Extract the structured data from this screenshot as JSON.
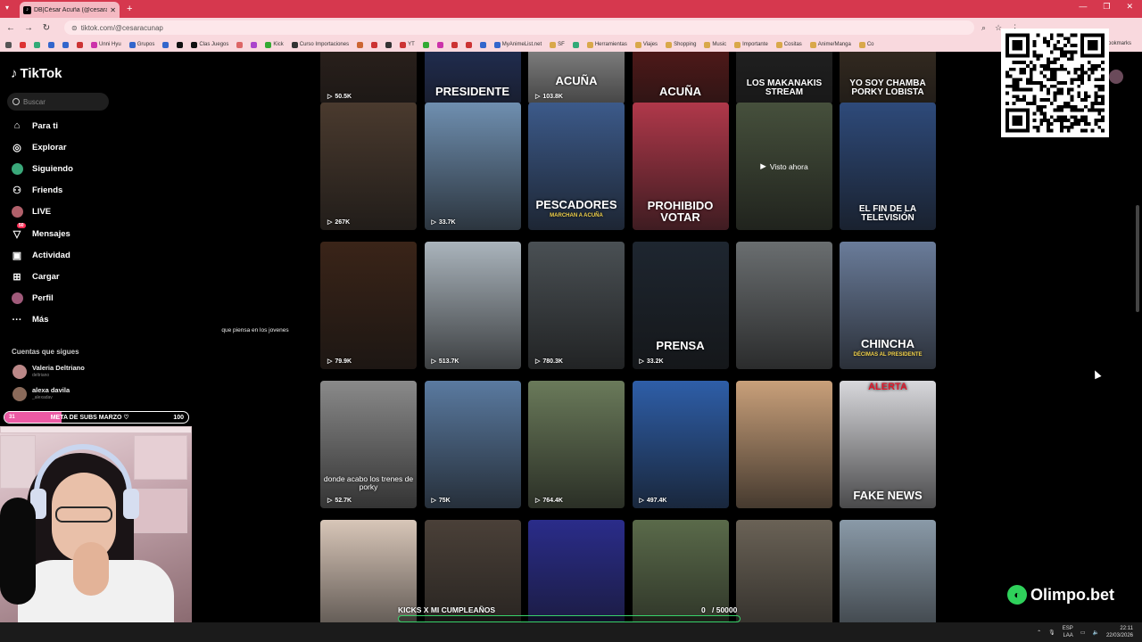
{
  "browser": {
    "tab_title": "DB|César Acuña (@cesaracunap",
    "url": "tiktok.com/@cesaracunap",
    "bookmarks": [
      "",
      "",
      "",
      "",
      "",
      "",
      "Unni Hyu",
      "Grupos",
      "",
      "",
      "Clas Juegos",
      "",
      "",
      "Kick",
      "Curso Importaciones",
      "",
      "",
      "",
      "YT",
      "",
      "",
      "",
      "",
      "",
      "MyAnimeList.net",
      "SF",
      "",
      "Herramientas",
      "Viajes",
      "Shopping",
      "Music",
      "Importante",
      "Cositas",
      "Anime/Manga",
      "Co"
    ],
    "bookmarks_right": "Bookmarks"
  },
  "sidebar": {
    "logo": "TikTok",
    "search_placeholder": "Buscar",
    "items": [
      {
        "label": "Para ti",
        "icon": "home-icon"
      },
      {
        "label": "Explorar",
        "icon": "compass-icon"
      },
      {
        "label": "Siguiendo",
        "icon": "following-icon"
      },
      {
        "label": "Friends",
        "icon": "friends-icon"
      },
      {
        "label": "LIVE",
        "icon": "live-icon"
      },
      {
        "label": "Mensajes",
        "icon": "messages-icon",
        "badge": "50"
      },
      {
        "label": "Actividad",
        "icon": "activity-icon"
      },
      {
        "label": "Cargar",
        "icon": "upload-icon"
      },
      {
        "label": "Perfil",
        "icon": "profile-icon"
      },
      {
        "label": "Más",
        "icon": "more-icon"
      }
    ],
    "following_title": "Cuentas que sigues",
    "following": [
      {
        "name": "Valeria Deltriano",
        "handle": "deltriano"
      },
      {
        "name": "alexa davila",
        "handle": "_alexadav"
      }
    ]
  },
  "subs_bar": {
    "current": "31",
    "label": "META DE SUBS MARZO ♡",
    "goal": "100",
    "progress": 0.31
  },
  "videos": [
    {
      "views": "50.5K",
      "caption": "",
      "bg": "#3a2a22"
    },
    {
      "views": "",
      "caption": "PRESIDENTE",
      "bg": "#2b3f7a"
    },
    {
      "views": "103.8K",
      "caption": "ACUÑA",
      "bg": "#c8c8c8"
    },
    {
      "views": "",
      "caption": "ACUÑA",
      "bg": "#7a1e1e"
    },
    {
      "views": "",
      "caption": "LOS MAKANAKIS STREAM",
      "bg": "#2a2a2a"
    },
    {
      "views": "",
      "caption": "YO SOY CHAMBA PORKY LOBISTA",
      "bg": "#4a3a2a"
    },
    {
      "views": "267K",
      "caption": "",
      "bg": "#4a3a2e"
    },
    {
      "views": "33.7K",
      "caption": "",
      "bg": "#6f8fb0"
    },
    {
      "views": "",
      "caption": "PESCADORES",
      "sub": "MARCHAN A ACUÑA",
      "bg": "#3c5a8a"
    },
    {
      "views": "",
      "caption": "PROHIBIDO VOTAR",
      "bg": "#b0384a"
    },
    {
      "views": "",
      "caption": "",
      "watched": "Visto ahora",
      "bg": "#46503c"
    },
    {
      "views": "",
      "caption": "EL FIN DE LA TELEVISIÓN",
      "bg": "#2e4a7a"
    },
    {
      "views": "79.9K",
      "caption": "",
      "bg": "#3a2418"
    },
    {
      "views": "513.7K",
      "caption": "",
      "bg": "#aab4bc"
    },
    {
      "views": "780.3K",
      "caption": "",
      "bg": "#4a5054"
    },
    {
      "views": "33.2K",
      "caption": "PRENSA",
      "bg": "#1e2630"
    },
    {
      "views": "",
      "caption": "",
      "bg": "#6a6e70"
    },
    {
      "views": "",
      "caption": "CHINCHA",
      "sub": "DÉCIMAS AL PRESIDENTE",
      "bg": "#6a7c9a"
    },
    {
      "views": "52.7K",
      "caption": "donde acabo los trenes de porky",
      "bg": "#8a8a8a"
    },
    {
      "views": "75K",
      "caption": "",
      "bg": "#5a7aa0"
    },
    {
      "views": "764.4K",
      "caption": "",
      "bg": "#6a7a5a"
    },
    {
      "views": "497.4K",
      "caption": "",
      "bg": "#2e5ea8"
    },
    {
      "views": "",
      "caption": "",
      "bg": "#c9a07a"
    },
    {
      "views": "",
      "caption": "FAKE NEWS",
      "top": "ALERTA",
      "bg": "#d8d8dc"
    },
    {
      "views": "",
      "caption": "",
      "bg": "#d8c6b8"
    },
    {
      "views": "",
      "caption": "",
      "bg": "#4a4038"
    },
    {
      "views": "",
      "caption": "",
      "bg": "#2a2c8a"
    },
    {
      "views": "",
      "caption": "",
      "bg": "#5a6a4a"
    },
    {
      "views": "",
      "caption": "",
      "bg": "#6a6256"
    },
    {
      "views": "",
      "caption": "",
      "bg": "#8a9aa8"
    }
  ],
  "above_caption": "que piensa en los jovenes",
  "overlay": {
    "goal_label": "KICKS X MI CUMPLEAÑOS",
    "goal_value": "0",
    "goal_total": "/ 50000",
    "sponsor": "Olimpo.bet"
  },
  "taskbar": {
    "lang1": "ESP",
    "lang2": "LAA",
    "time": "22:11",
    "date": "22/03/2026"
  }
}
